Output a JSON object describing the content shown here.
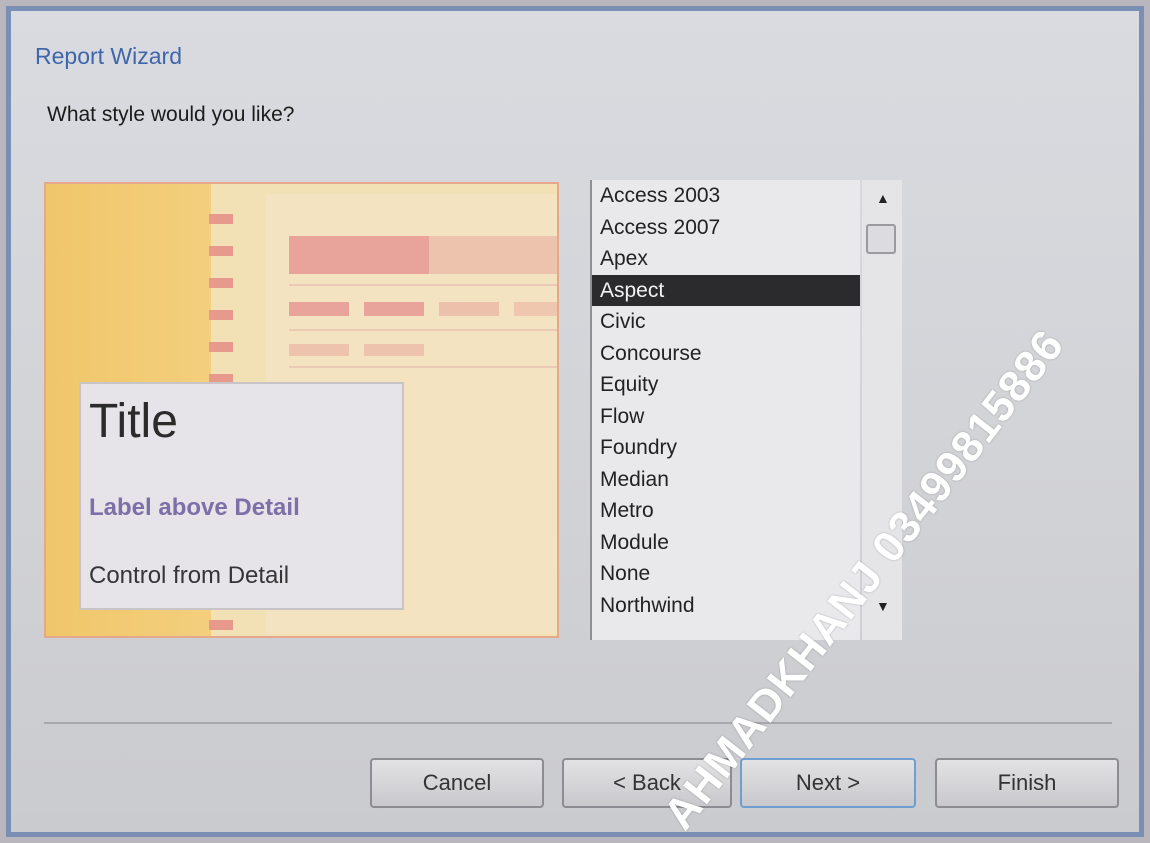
{
  "window": {
    "title": "Report Wizard"
  },
  "question": "What style would you like?",
  "preview": {
    "title": "Title",
    "label": "Label above Detail",
    "control": "Control from Detail"
  },
  "styles": {
    "items": [
      "Access 2003",
      "Access 2007",
      "Apex",
      "Aspect",
      "Civic",
      "Concourse",
      "Equity",
      "Flow",
      "Foundry",
      "Median",
      "Metro",
      "Module",
      "None",
      "Northwind"
    ],
    "selected": "Aspect"
  },
  "buttons": {
    "cancel": "Cancel",
    "back": "< Back",
    "next": "Next >",
    "finish": "Finish"
  },
  "watermark": "AHMADKHANJ 03499815886",
  "colors": {
    "title": "#3f66a8",
    "selection": "#2b2b2e",
    "preview_accent": "#f0c66a"
  }
}
